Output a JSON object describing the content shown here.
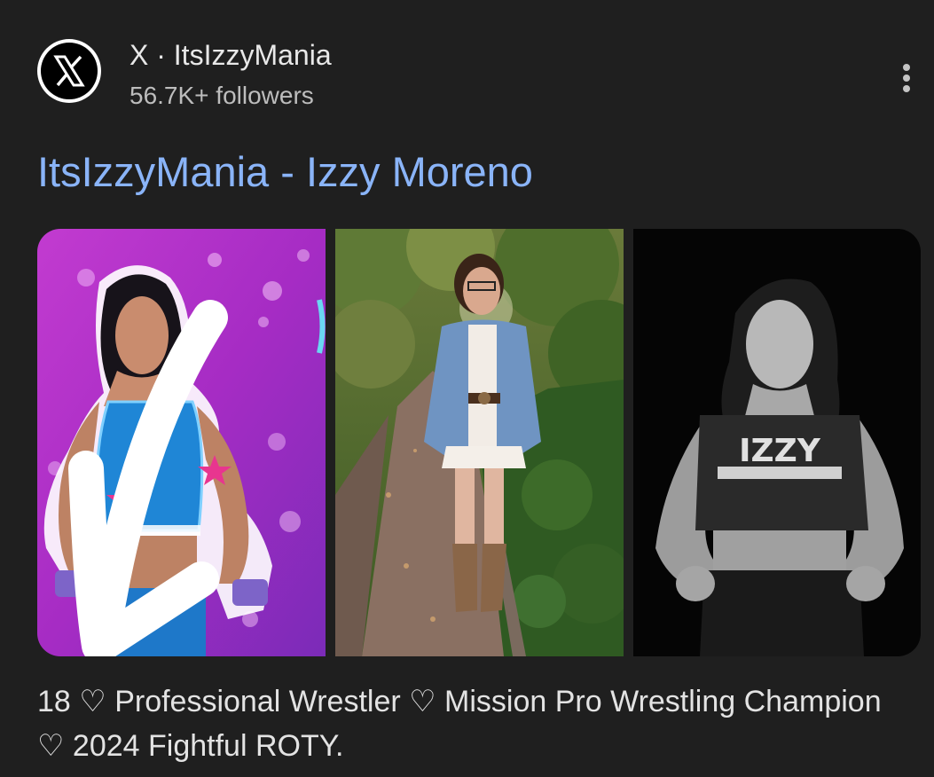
{
  "result": {
    "source": {
      "logo_icon": "x-logo-icon",
      "title": "X · ItsIzzyMania",
      "followers": "56.7K+ followers",
      "more_icon": "more-vert-icon"
    },
    "headline": "ItsIzzyMania - Izzy Moreno",
    "images": [
      {
        "description_icon": "photo-wrestler-purple-background"
      },
      {
        "description_icon": "photo-woman-outdoors-path"
      },
      {
        "description_icon": "photo-black-and-white-portrait"
      }
    ],
    "image3_shirt_text": "IZZY",
    "description": "18 ♡ Professional Wrestler ♡ Mission Pro Wrestling Champion ♡ 2024 Fightful ROTY."
  },
  "colors": {
    "background": "#1f1f1f",
    "link": "#8ab4f8",
    "text": "#e3e3e3",
    "muted": "#bdbdbd"
  }
}
